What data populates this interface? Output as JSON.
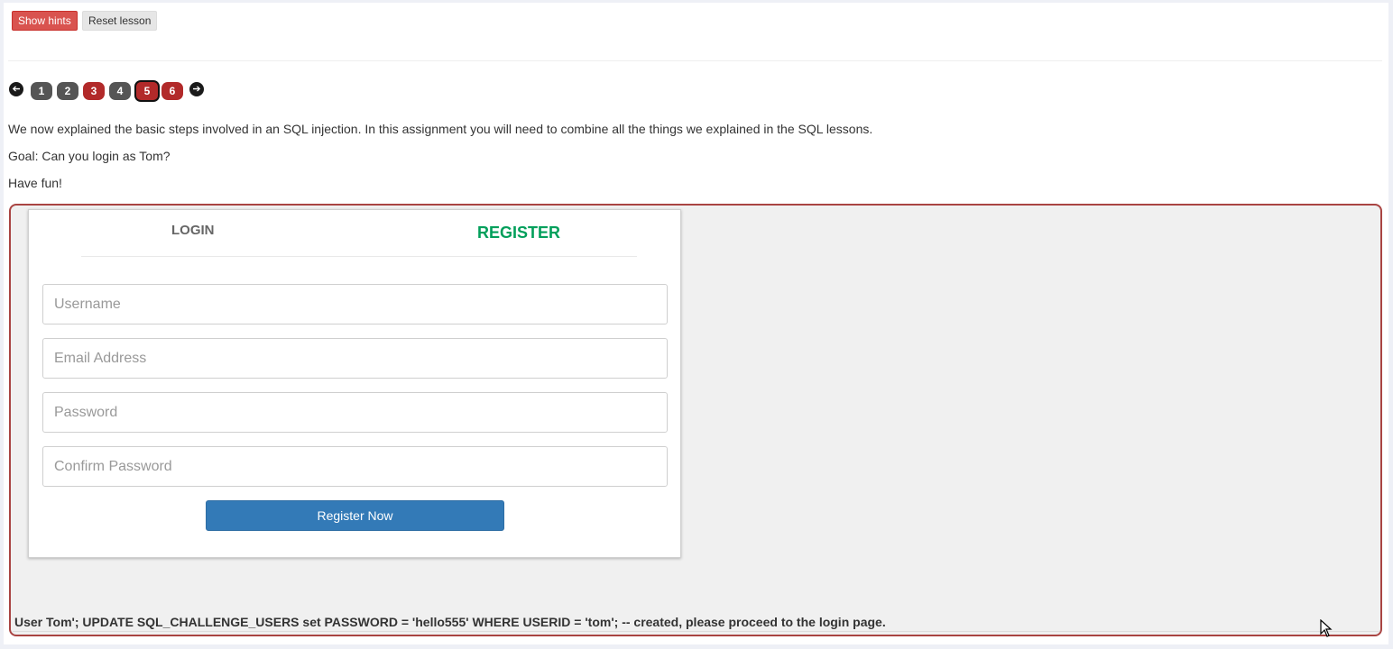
{
  "toolbar": {
    "show_hints_label": "Show hints",
    "reset_lesson_label": "Reset lesson"
  },
  "pagination": {
    "prev_icon": "arrow-left-icon",
    "next_icon": "arrow-right-icon",
    "pages": [
      {
        "label": "1",
        "status": "gray"
      },
      {
        "label": "2",
        "status": "gray"
      },
      {
        "label": "3",
        "status": "red"
      },
      {
        "label": "4",
        "status": "gray"
      },
      {
        "label": "5",
        "status": "red",
        "current": true
      },
      {
        "label": "6",
        "status": "red"
      }
    ]
  },
  "lesson": {
    "paragraph1": "We now explained the basic steps involved in an SQL injection. In this assignment you will need to combine all the things we explained in the SQL lessons.",
    "paragraph2": "Goal: Can you login as Tom?",
    "paragraph3": "Have fun!"
  },
  "form": {
    "tab_login": "LOGIN",
    "tab_register": "REGISTER",
    "username_placeholder": "Username",
    "email_placeholder": "Email Address",
    "password_placeholder": "Password",
    "confirm_password_placeholder": "Confirm Password",
    "register_button": "Register Now"
  },
  "feedback": {
    "message": "User Tom'; UPDATE SQL_CHALLENGE_USERS set PASSWORD = 'hello555' WHERE USERID = 'tom'; -- created, please proceed to the login page."
  },
  "colors": {
    "hint_button": "#d9534f",
    "page_red": "#b22a2a",
    "page_gray": "#555555",
    "register_tab": "#029f5b",
    "register_button": "#337ab7",
    "attack_border": "#a94442"
  }
}
